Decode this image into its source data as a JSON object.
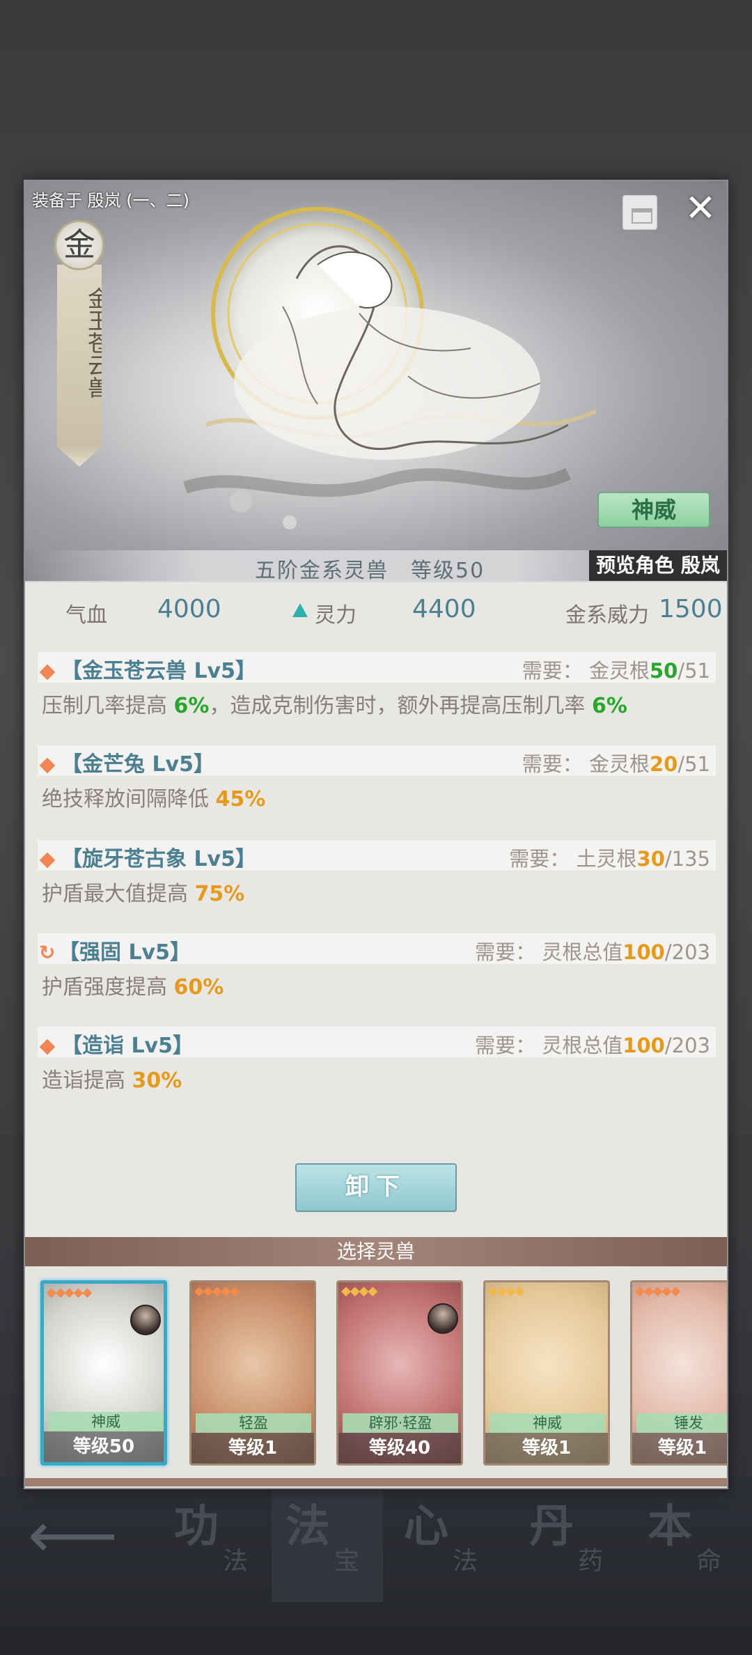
{
  "bottom_nav": [
    {
      "big": "功",
      "small": "法"
    },
    {
      "big": "法",
      "small": "宝"
    },
    {
      "big": "心",
      "small": "法"
    },
    {
      "big": "丹",
      "small": "药"
    },
    {
      "big": "本",
      "small": "命"
    }
  ],
  "hero": {
    "equipped_on": "装备于 殷岚 (一、二)",
    "element": "金",
    "beast_name": "金玉苍云兽",
    "tag_button": "神威",
    "grade": "五阶金系灵兽　等级50",
    "preview": "预览角色 殷岚"
  },
  "stats": {
    "hp_label": "气血",
    "hp_value": "4000",
    "spirit_label": "灵力",
    "spirit_value": "4400",
    "metal_label": "金系威力",
    "metal_value": "1500"
  },
  "skills": [
    {
      "name": "【金玉苍云兽 Lv5】",
      "req_label": "需要：",
      "req_type": "金灵根",
      "req_have": "50",
      "req_total": "/51",
      "desc_a": "压制几率提高 ",
      "val_a": "6%",
      "desc_b": "，造成克制伤害时，额外再提高压制几率 ",
      "val_b": "6%"
    },
    {
      "name": "【金芒兔 Lv5】",
      "req_label": "需要：",
      "req_type": "金灵根",
      "req_have": "20",
      "req_total": "/51",
      "desc_a": "绝技释放间隔降低 ",
      "val_a": "45%"
    },
    {
      "name": "【旋牙苍古象 Lv5】",
      "req_label": "需要：",
      "req_type": "土灵根",
      "req_have": "30",
      "req_total": "/135",
      "desc_a": "护盾最大值提高 ",
      "val_a": "75%"
    },
    {
      "name": "【强固 Lv5】",
      "req_label": "需要：",
      "req_type": "灵根总值",
      "req_have": "100",
      "req_total": "/203",
      "desc_a": "护盾强度提高 ",
      "val_a": "60%"
    },
    {
      "name": "【造诣 Lv5】",
      "req_label": "需要：",
      "req_type": "灵根总值",
      "req_have": "100",
      "req_total": "/203",
      "desc_a": "造诣提高 ",
      "val_a": "30%"
    }
  ],
  "unequip_label": "卸下",
  "select_title": "选择灵兽",
  "cards": [
    {
      "tag": "神威",
      "level": "等级50"
    },
    {
      "tag": "轻盈",
      "level": "等级1"
    },
    {
      "tag": "辟邪·轻盈",
      "level": "等级40"
    },
    {
      "tag": "神威",
      "level": "等级1"
    },
    {
      "tag": "锤发",
      "level": "等级1"
    }
  ],
  "colors": {
    "accent_teal": "#4b7f92",
    "green": "#29a62e",
    "orange": "#e49a1d"
  }
}
